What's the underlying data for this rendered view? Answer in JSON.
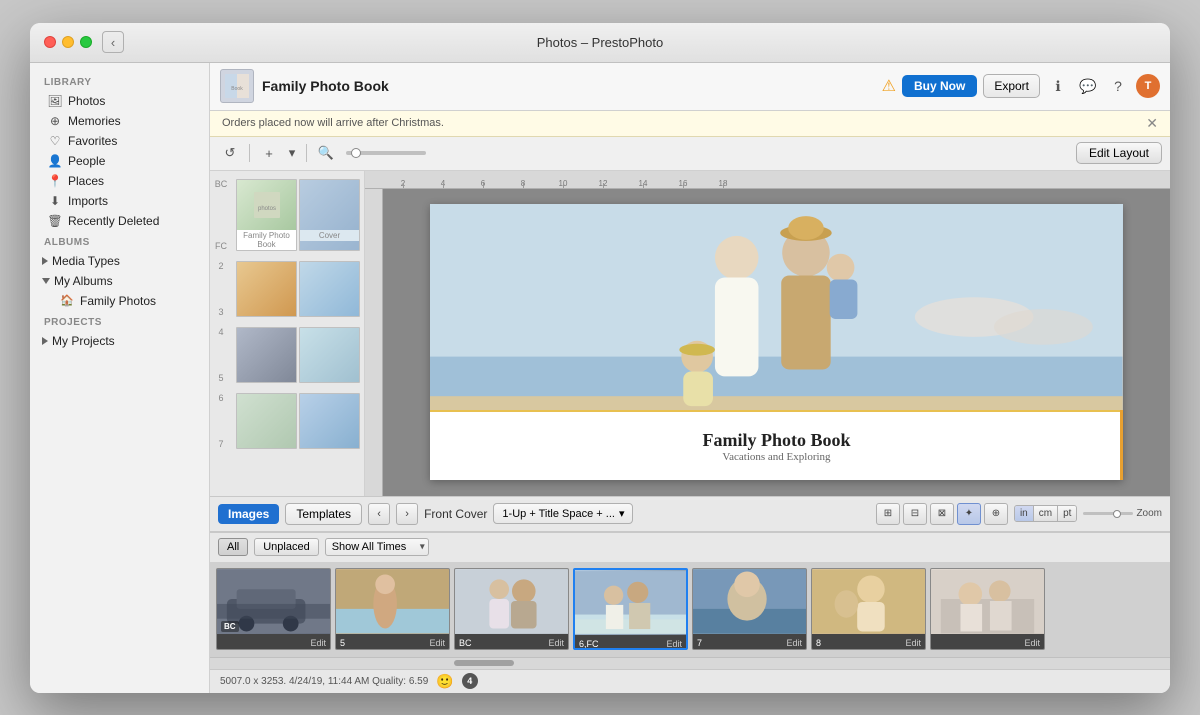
{
  "window": {
    "title": "Photos – PrestoPhoto"
  },
  "sidebar": {
    "library_header": "Library",
    "items": [
      {
        "label": "Photos",
        "icon": "🖼"
      },
      {
        "label": "Memories",
        "icon": "⊕"
      },
      {
        "label": "Favorites",
        "icon": "♡"
      },
      {
        "label": "People",
        "icon": "👤"
      },
      {
        "label": "Places",
        "icon": "📍"
      },
      {
        "label": "Imports",
        "icon": "⬇"
      },
      {
        "label": "Recently Deleted",
        "icon": "🗑"
      }
    ],
    "albums_header": "Albums",
    "albums": [
      {
        "label": "Media Types",
        "expanded": false
      },
      {
        "label": "My Albums",
        "expanded": true
      },
      {
        "label": "Family Photos",
        "icon": "🏠",
        "sub": true
      }
    ],
    "projects_header": "Projects",
    "projects": [
      {
        "label": "My Projects",
        "expanded": false
      }
    ]
  },
  "book_header": {
    "title": "Family Photo Book",
    "subtitle": "Orders placed now will arrive after Christmas.",
    "buy_now_label": "Buy Now",
    "export_label": "Export",
    "edit_layout_label": "Edit Layout",
    "user_initial": "T"
  },
  "toolbar": {
    "zoom_label": "Zoom"
  },
  "canvas": {
    "book_title": "Family Photo Book",
    "book_subtitle": "Vacations and Exploring"
  },
  "bottom_toolbar": {
    "images_label": "Images",
    "templates_label": "Templates",
    "page_indicator": "Front Cover",
    "layout_dropdown": "1-Up + Title Space + ...",
    "units": [
      "in",
      "cm",
      "pt"
    ],
    "zoom_label": "Zoom"
  },
  "filter_bar": {
    "all_label": "All",
    "unplaced_label": "Unplaced",
    "time_filter": "Show All Times"
  },
  "thumbnails": [
    {
      "label_top": "BC",
      "label_bottom": "FC",
      "pages": 2
    },
    {
      "label_top": "2",
      "label_bottom": "3",
      "pages": 2
    },
    {
      "label_top": "4",
      "label_bottom": "5",
      "pages": 2
    },
    {
      "label_top": "6",
      "label_bottom": "7",
      "pages": 2
    }
  ],
  "filmstrip": [
    {
      "label": "",
      "badge": "BC",
      "edit": "Edit"
    },
    {
      "label": "5",
      "badge": "",
      "edit": "Edit"
    },
    {
      "label": "BC",
      "badge": "",
      "edit": "Edit"
    },
    {
      "label": "6,FC",
      "badge": "",
      "edit": "Edit",
      "selected": true
    },
    {
      "label": "7",
      "badge": "",
      "edit": "Edit"
    },
    {
      "label": "8",
      "badge": "",
      "edit": "Edit"
    },
    {
      "label": "",
      "badge": "",
      "edit": "Edit"
    }
  ],
  "status_bar": {
    "info": "5007.0 x 3253. 4/24/19, 11:44 AM  Quality: 6.59",
    "count": "4"
  },
  "ruler": {
    "ticks": [
      "2",
      "4",
      "6",
      "8",
      "10",
      "12",
      "14",
      "16",
      "18"
    ]
  }
}
